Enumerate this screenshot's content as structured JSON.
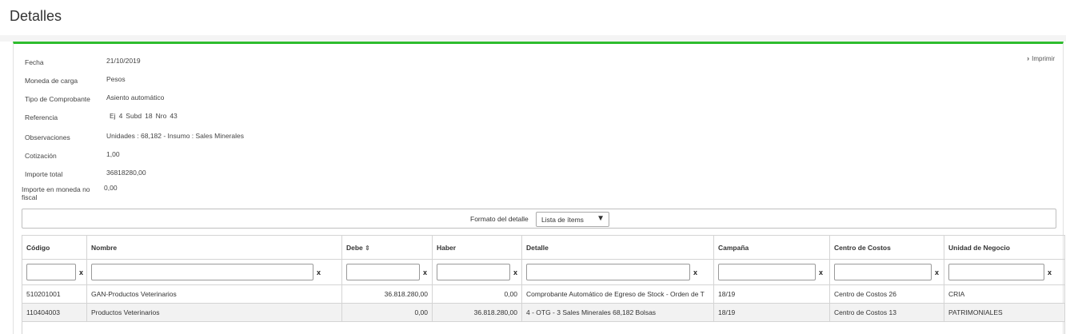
{
  "page": {
    "title": "Detalles",
    "print_label": "Imprimir"
  },
  "fields": {
    "fecha": {
      "label": "Fecha",
      "value": "21/10/2019"
    },
    "moneda": {
      "label": "Moneda de carga",
      "value": "Pesos"
    },
    "tipo": {
      "label": "Tipo de Comprobante",
      "value": "Asiento automático"
    },
    "referencia": {
      "label": "Referencia",
      "ej_label": "Ej",
      "ej": "4",
      "subd_label": "Subd",
      "subd": "18",
      "nro_label": "Nro",
      "nro": "43"
    },
    "observaciones": {
      "label": "Observaciones",
      "value": "Unidades : 68,182 - Insumo : Sales Minerales"
    },
    "cotizacion": {
      "label": "Cotización",
      "value": "1,00"
    },
    "importe_total": {
      "label": "Importe total",
      "value": "36818280,00"
    },
    "importe_no_fiscal": {
      "label_1": "Importe en moneda no",
      "label_2": "fiscal",
      "value": "0,00"
    }
  },
  "format": {
    "label": "Formato del detalle",
    "selected": "Lista de ítems"
  },
  "table": {
    "headers": {
      "codigo": "Código",
      "nombre": "Nombre",
      "debe": "Debe",
      "haber": "Haber",
      "detalle": "Detalle",
      "campana": "Campaña",
      "centro": "Centro de Costos",
      "unidad": "Unidad de Negocio"
    },
    "filter_clear": "x",
    "rows": [
      {
        "codigo": "510201001",
        "nombre": "GAN-Productos Veterinarios",
        "debe": "36.818.280,00",
        "haber": "0,00",
        "detalle": "Comprobante Automático de Egreso de Stock - Orden de T",
        "campana": "18/19",
        "centro": "Centro de Costos 26",
        "unidad": "CRIA"
      },
      {
        "codigo": "110404003",
        "nombre": "Productos Veterinarios",
        "debe": "0,00",
        "haber": "36.818.280,00",
        "detalle": "4 - OTG - 3 Sales Minerales 68,182 Bolsas",
        "campana": "18/19",
        "centro": "Centro de Costos 13",
        "unidad": "PATRIMONIALES"
      }
    ]
  }
}
